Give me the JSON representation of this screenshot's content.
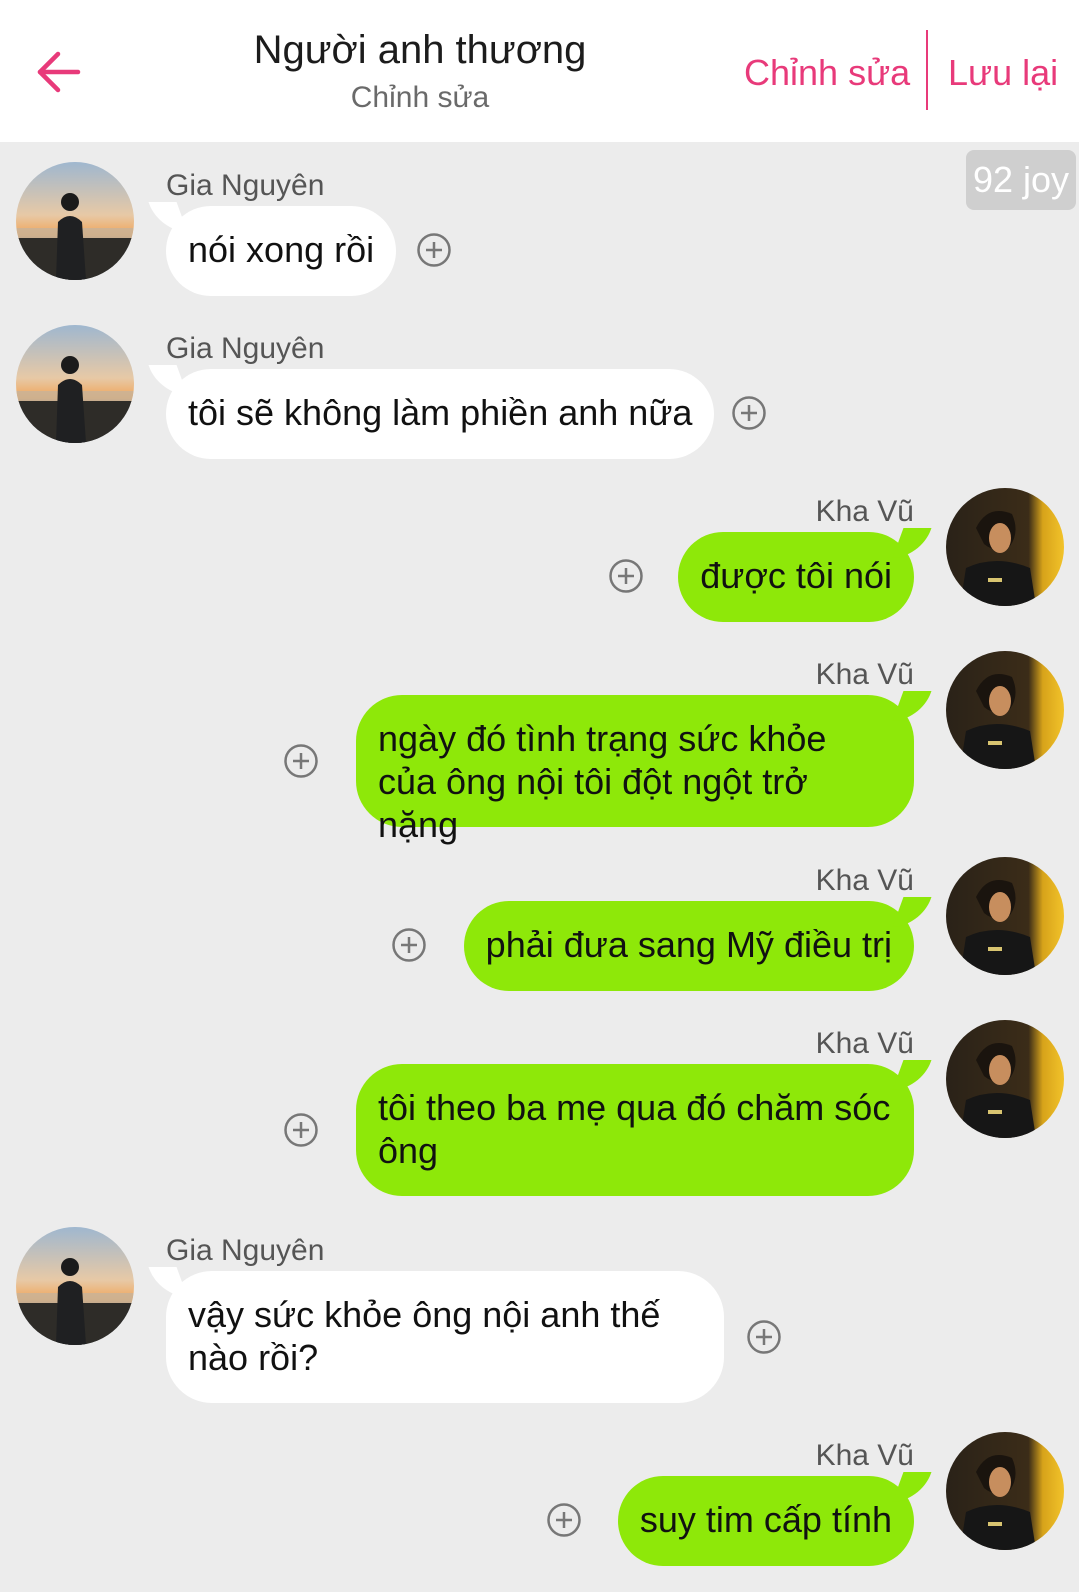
{
  "header": {
    "title": "Người anh thương",
    "subtitle": "Chỉnh sửa",
    "edit_label": "Chỉnh sửa",
    "save_label": "Lưu lại",
    "accent_color": "#e83a7a"
  },
  "badge": "92 joy",
  "colors": {
    "incoming_bubble": "#ffffff",
    "outgoing_bubble": "#8ee809",
    "background": "#ececec"
  },
  "messages": [
    {
      "side": "left",
      "sender": "Gia Nguyên",
      "text": "nói xong rồi",
      "icon": "add-circle-icon"
    },
    {
      "side": "left",
      "sender": "Gia Nguyên",
      "text": "tôi sẽ không làm phiền anh nữa",
      "icon": "add-circle-icon"
    },
    {
      "side": "right",
      "sender": "Kha Vũ",
      "text": "được tôi nói",
      "icon": "add-circle-icon"
    },
    {
      "side": "right",
      "sender": "Kha Vũ",
      "text": "ngày đó tình trạng sức khỏe của ông nội tôi đột ngột trở nặng",
      "icon": "add-circle-icon"
    },
    {
      "side": "right",
      "sender": "Kha Vũ",
      "text": "phải đưa sang Mỹ điều trị",
      "icon": "add-circle-icon"
    },
    {
      "side": "right",
      "sender": "Kha Vũ",
      "text": "tôi theo ba mẹ qua đó chăm sóc ông",
      "icon": "add-circle-icon"
    },
    {
      "side": "left",
      "sender": "Gia Nguyên",
      "text": "vậy sức khỏe ông nội anh thế nào rồi?",
      "icon": "add-circle-icon"
    },
    {
      "side": "right",
      "sender": "Kha Vũ",
      "text": "suy tim cấp tính",
      "icon": "add-circle-icon"
    }
  ]
}
